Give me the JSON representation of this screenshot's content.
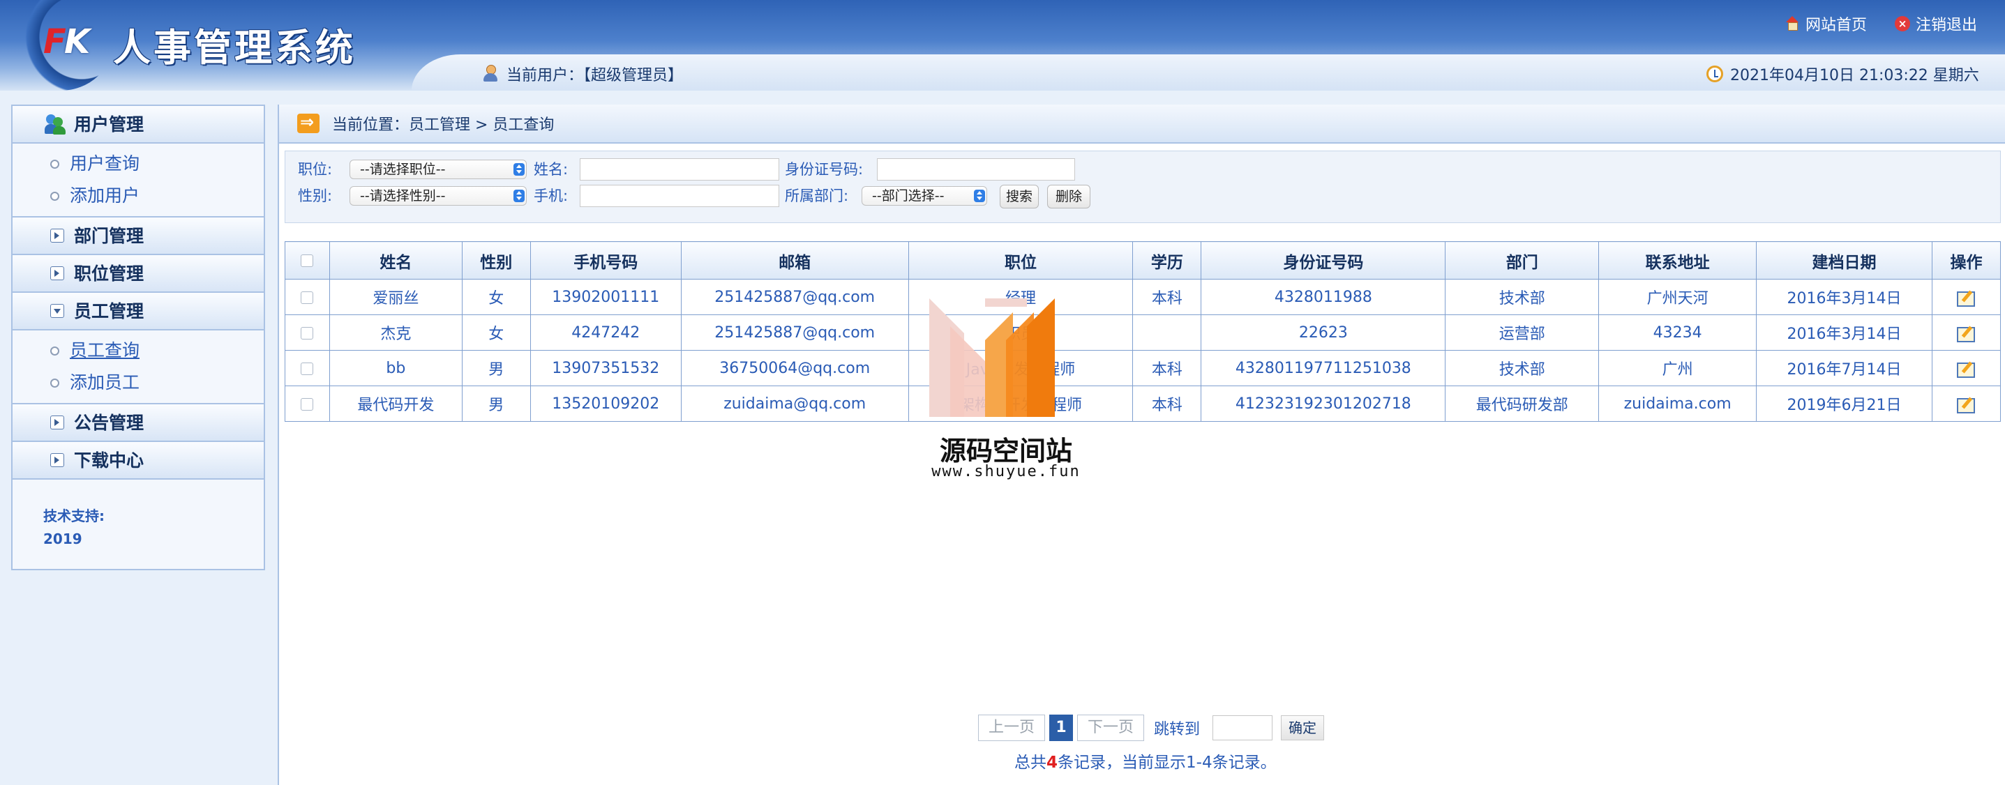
{
  "header": {
    "logo_f": "F",
    "logo_k": "K",
    "title": "人事管理系统",
    "home_link": "网站首页",
    "logout_link": "注销退出",
    "current_user": "当前用户：【超级管理员】",
    "datetime": "2021年04月10日 21:03:22 星期六"
  },
  "sidebar": {
    "groups": [
      {
        "label": "用户管理",
        "items": [
          "用户查询",
          "添加用户"
        ]
      },
      {
        "label": "部门管理"
      },
      {
        "label": "职位管理"
      },
      {
        "label": "员工管理",
        "items": [
          "员工查询",
          "添加员工"
        ]
      },
      {
        "label": "公告管理"
      },
      {
        "label": "下载中心"
      }
    ],
    "support_label": "技术支持:",
    "support_year": "2019"
  },
  "breadcrumb": "当前位置：员工管理 > 员工查询",
  "filter": {
    "position_label": "职位:",
    "position_select": "--请选择职位--",
    "name_label": "姓名:",
    "idcard_label": "身份证号码:",
    "sex_label": "性别:",
    "sex_select": "--请选择性别--",
    "phone_label": "手机:",
    "dept_label": "所属部门:",
    "dept_select": "--部门选择--",
    "search_btn": "搜索",
    "delete_btn": "删除"
  },
  "table": {
    "headers": [
      "姓名",
      "性别",
      "手机号码",
      "邮箱",
      "职位",
      "学历",
      "身份证号码",
      "部门",
      "联系地址",
      "建档日期",
      "操作"
    ],
    "rows": [
      [
        "爱丽丝",
        "女",
        "13902001111",
        "251425887@qq.com",
        "经理",
        "本科",
        "4328011988",
        "技术部",
        "广州天河",
        "2016年3月14日"
      ],
      [
        "杰克",
        "女",
        "4247242",
        "251425887@qq.com",
        "职员",
        "",
        "22623",
        "运营部",
        "43234",
        "2016年3月14日"
      ],
      [
        "bb",
        "男",
        "13907351532",
        "36750064@qq.com",
        "Java开发工程师",
        "本科",
        "432801197711251038",
        "技术部",
        "广州",
        "2016年7月14日"
      ],
      [
        "最代码开发",
        "男",
        "13520109202",
        "zuidaima@qq.com",
        "架构师开发工程师",
        "本科",
        "412323192301202718",
        "最代码研发部",
        "zuidaima.com",
        "2019年6月21日"
      ]
    ]
  },
  "watermark": {
    "title": "源码空间站",
    "url": "www.shuyue.fun"
  },
  "pager": {
    "prev": "上一页",
    "current": "1",
    "next": "下一页",
    "jump_label": "跳转到",
    "ok": "确定"
  },
  "summary": {
    "prefix": "总共",
    "total": "4",
    "suffix": "条记录，当前显示1-4条记录。"
  }
}
